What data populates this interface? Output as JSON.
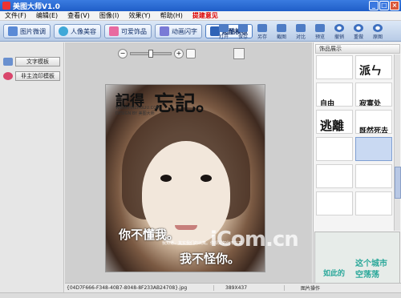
{
  "window": {
    "title": "美图大师V1.0",
    "buttons": [
      "_",
      "□",
      "×"
    ]
  },
  "menu": [
    "文件(F)",
    "编辑(E)",
    "查看(V)",
    "图像(I)",
    "效果(Y)",
    "帮助(H)",
    "提建意见"
  ],
  "mode_tabs": [
    {
      "label": "图片微调",
      "icon": "photo-adjust-icon"
    },
    {
      "label": "人像美容",
      "icon": "face-beauty-icon"
    },
    {
      "label": "可爱饰品",
      "icon": "accessory-icon"
    },
    {
      "label": "动画闪字",
      "icon": "animation-icon"
    },
    {
      "label": "超酷模板",
      "icon": "template-icon",
      "active": true
    }
  ],
  "tools": [
    "打开",
    "保存",
    "另存",
    "截图",
    "对比",
    "预览",
    "撤销",
    "重做",
    "原图"
  ],
  "left_panel": {
    "items": [
      "文字模板",
      "非主流印模板"
    ]
  },
  "zoom": {
    "minus": "−",
    "plus": "+"
  },
  "photo_text": {
    "title_small": "記得",
    "title_big": "忘記。",
    "small1": "WWW.FEIZHULIU.COM",
    "small2": "DESIGN BY 美图大师",
    "bottom1": "你不懂我。",
    "bottom_small": "我知道，其实我们的出离。你却是如此不在意",
    "bottom2": "我不怪你。"
  },
  "watermark": "iCom.cn",
  "right_panel": {
    "title": "饰品展示",
    "cells": [
      {
        "text": "",
        "sub": ""
      },
      {
        "text": "派ㄣ",
        "sub": ""
      },
      {
        "text": "",
        "sub": ""
      },
      {
        "text": "",
        "sub": "自由"
      },
      {
        "text": "",
        "sub": "寂寞处"
      },
      {
        "text": "",
        "sub": ""
      },
      {
        "text": "逃離",
        "sub": ""
      },
      {
        "text": "",
        "sub": "既然死去"
      },
      {
        "text": "",
        "sub": ""
      },
      {
        "text": "",
        "sub": ""
      },
      {
        "text": "",
        "sub": ""
      },
      {
        "text": "",
        "sub": ""
      }
    ],
    "preview": [
      "这个城市",
      "如此的",
      "空荡荡"
    ]
  },
  "status": {
    "file": "{04D7F666-F348-40B7-8048-8F233AB24708}.jpg",
    "dim": "389X437",
    "op": "图片操作"
  }
}
